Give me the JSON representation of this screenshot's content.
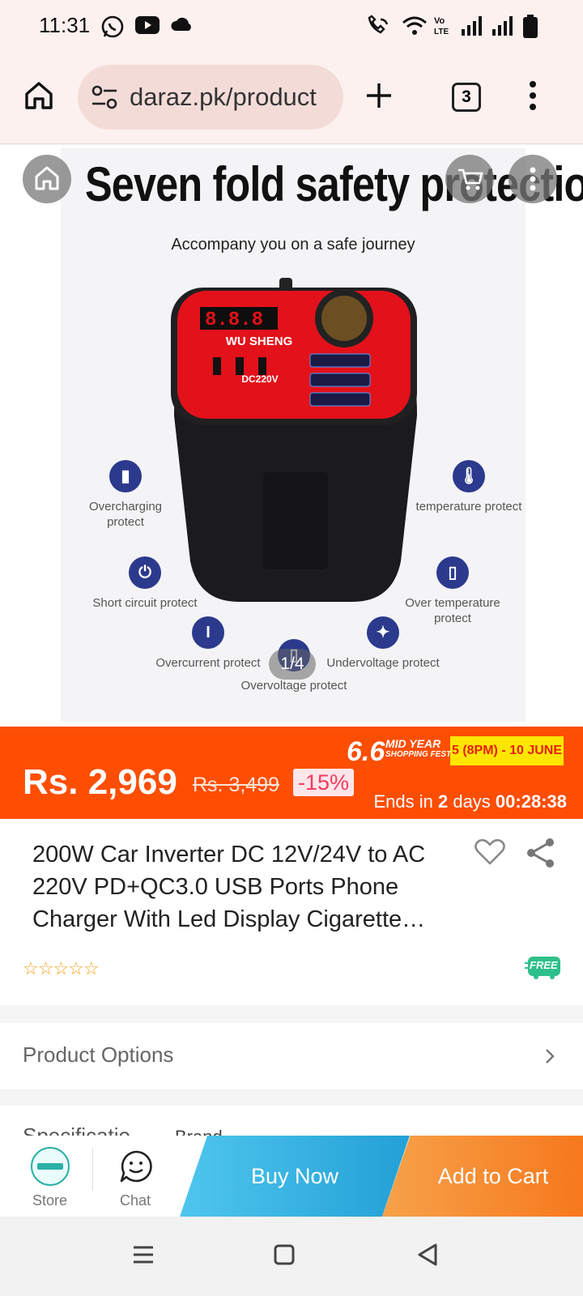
{
  "status_bar": {
    "time": "11:31",
    "icons": [
      "whatsapp-icon",
      "youtube-icon",
      "cloud-icon",
      "wifi-call-icon",
      "wifi-icon",
      "volte-icon",
      "signal-icon",
      "signal-icon",
      "battery-icon"
    ]
  },
  "browser": {
    "url": "daraz.pk/product",
    "tab_count": "3"
  },
  "gallery": {
    "headline": "Seven fold safety protection",
    "subhead": "Accompany you on a safe journey",
    "device_label": "WU SHENG",
    "device_voltage": "DC220V",
    "features": [
      "Overcharging protect",
      "temperature protect",
      "Short circuit protect",
      "Over temperature protect",
      "Overcurrent protect",
      "Undervoltage protect",
      "Overvoltage protect"
    ],
    "counter": "1/4"
  },
  "price": {
    "current": "Rs. 2,969",
    "original": "Rs. 3,499",
    "discount": "-15%",
    "campaign": "6.6",
    "campaign_sub_1": "MID YEAR",
    "campaign_sub_2": "SHOPPING FEST!",
    "campaign_dates": "5 (8PM) - 10 JUNE",
    "ends_prefix": "Ends in ",
    "ends_days": "2",
    "ends_days_label": " days ",
    "ends_time": "00:28:38"
  },
  "product": {
    "title": "200W Car Inverter DC 12V/24V to AC 220V PD+QC3.0 USB Ports Phone Charger With Led Display Cigarette…",
    "stars": "☆☆☆☆☆",
    "free_badge": "FREE"
  },
  "sections": {
    "options_label": "Product Options",
    "spec_label": "Specificatio",
    "spec_value": "Brand"
  },
  "actions": {
    "store_label": "Store",
    "chat_label": "Chat",
    "buy_now": "Buy Now",
    "add_to_cart": "Add to Cart"
  }
}
